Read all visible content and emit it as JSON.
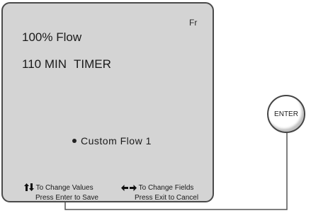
{
  "display": {
    "language": "Fr",
    "flow": "100% Flow",
    "timer_value": "110 MIN",
    "timer_label": "TIMER",
    "profile": "Custom Flow 1",
    "hints": {
      "change_values": "To Change Values",
      "change_fields": "To Change Fields",
      "save": "Press Enter to Save",
      "cancel": "Press Exit to Cancel"
    }
  },
  "enter_button": {
    "label": "ENTER"
  },
  "icons": {
    "values": "up-down-arrows-icon",
    "fields": "left-right-arrows-icon",
    "bullet": "bullet-icon"
  }
}
